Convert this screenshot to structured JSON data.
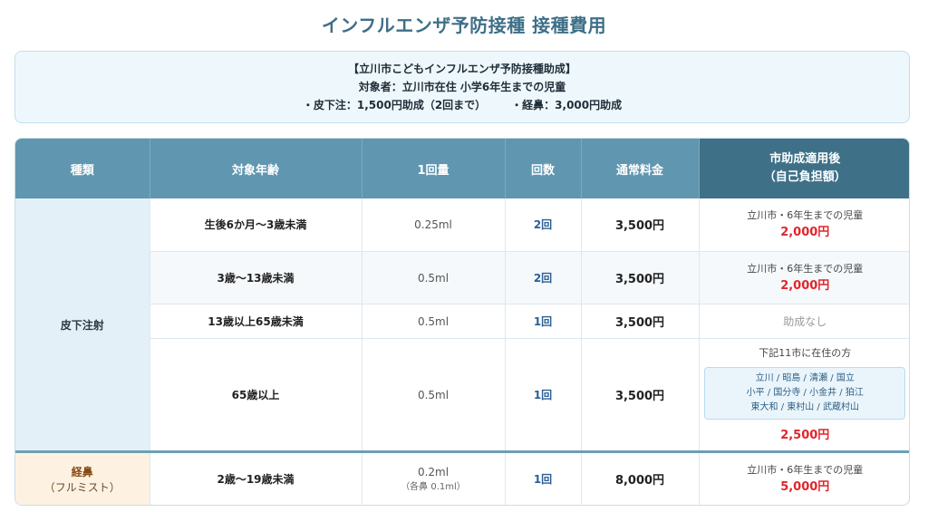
{
  "title": "インフルエンザ予防接種 接種費用",
  "info": {
    "line1": "【立川市こどもインフルエンザ予防接種助成】",
    "line2": "対象者：立川市在住 小学6年生までの児童",
    "line3a": "・皮下注：1,500円助成（2回まで）",
    "line3b": "・経鼻：3,000円助成"
  },
  "headers": {
    "kind": "種類",
    "age": "対象年齢",
    "dose": "1回量",
    "times": "回数",
    "fee": "通常料金",
    "after1": "市助成適用後",
    "after2": "（自己負担額）"
  },
  "subcutaneous": {
    "label": "皮下注射",
    "rows": [
      {
        "age": "生後6か月～3歳未満",
        "dose": "0.25ml",
        "times": "2回",
        "fee": "3,500円",
        "note": "立川市・6年生までの児童",
        "price": "2,000円"
      },
      {
        "age": "3歳～13歳未満",
        "dose": "0.5ml",
        "times": "2回",
        "fee": "3,500円",
        "note": "立川市・6年生までの児童",
        "price": "2,000円"
      },
      {
        "age": "13歳以上65歳未満",
        "dose": "0.5ml",
        "times": "1回",
        "fee": "3,500円",
        "none": "助成なし"
      },
      {
        "age": "65歳以上",
        "dose": "0.5ml",
        "times": "1回",
        "fee": "3,500円",
        "note": "下記11市に在住の方",
        "cities": [
          "立川 / 昭島 / 清瀬 / 国立",
          "小平 / 国分寺 / 小金井 / 狛江",
          "東大和 / 東村山 / 武蔵村山"
        ],
        "price": "2,500円"
      }
    ]
  },
  "nasal": {
    "label": "経鼻",
    "sublabel": "（フルミスト）",
    "age": "2歳～19歳未満",
    "dose": "0.2ml",
    "dose_sub": "（各鼻 0.1ml）",
    "times": "1回",
    "fee": "8,000円",
    "note": "立川市・6年生までの児童",
    "price": "5,000円"
  }
}
